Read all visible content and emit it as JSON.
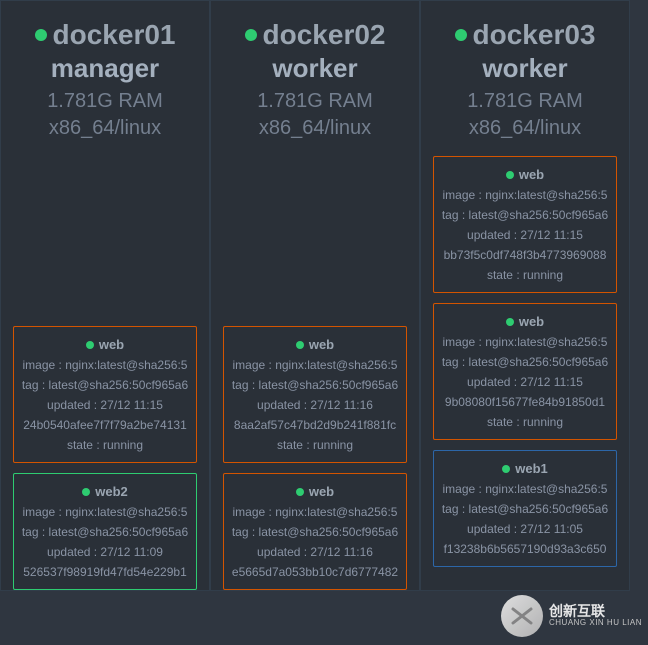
{
  "nodes": [
    {
      "name": "docker01",
      "role": "manager",
      "ram": "1.781G RAM",
      "arch": "x86_64/linux",
      "spacer": true,
      "containers": [
        {
          "title": "web",
          "border": "border-orange",
          "image": "image : nginx:latest@sha256:5",
          "tag": "tag : latest@sha256:50cf965a6",
          "updated": "updated : 27/12 11:15",
          "hash": "24b0540afee7f7f79a2be74131",
          "state": "state : running"
        },
        {
          "title": "web2",
          "border": "border-green",
          "image": "image : nginx:latest@sha256:5",
          "tag": "tag : latest@sha256:50cf965a6",
          "updated": "updated : 27/12 11:09",
          "hash": "526537f98919fd47fd54e229b1",
          "state": ""
        }
      ]
    },
    {
      "name": "docker02",
      "role": "worker",
      "ram": "1.781G RAM",
      "arch": "x86_64/linux",
      "spacer": true,
      "containers": [
        {
          "title": "web",
          "border": "border-orange",
          "image": "image : nginx:latest@sha256:5",
          "tag": "tag : latest@sha256:50cf965a6",
          "updated": "updated : 27/12 11:16",
          "hash": "8aa2af57c47bd2d9b241f881fc",
          "state": "state : running"
        },
        {
          "title": "web",
          "border": "border-orange",
          "image": "image : nginx:latest@sha256:5",
          "tag": "tag : latest@sha256:50cf965a6",
          "updated": "updated : 27/12 11:16",
          "hash": "e5665d7a053bb10c7d6777482",
          "state": ""
        }
      ]
    },
    {
      "name": "docker03",
      "role": "worker",
      "ram": "1.781G RAM",
      "arch": "x86_64/linux",
      "spacer": false,
      "containers": [
        {
          "title": "web",
          "border": "border-orange",
          "image": "image : nginx:latest@sha256:5",
          "tag": "tag : latest@sha256:50cf965a6",
          "updated": "updated : 27/12 11:15",
          "hash": "bb73f5c0df748f3b4773969088",
          "state": "state : running"
        },
        {
          "title": "web",
          "border": "border-orange",
          "image": "image : nginx:latest@sha256:5",
          "tag": "tag : latest@sha256:50cf965a6",
          "updated": "updated : 27/12 11:15",
          "hash": "9b08080f15677fe84b91850d1",
          "state": "state : running"
        },
        {
          "title": "web1",
          "border": "border-blue",
          "image": "image : nginx:latest@sha256:5",
          "tag": "tag : latest@sha256:50cf965a6",
          "updated": "updated : 27/12 11:05",
          "hash": "f13238b6b5657190d93a3c650",
          "state": ""
        }
      ]
    }
  ],
  "watermark": {
    "main": "创新互联",
    "sub": "CHUANG XIN HU LIAN"
  }
}
